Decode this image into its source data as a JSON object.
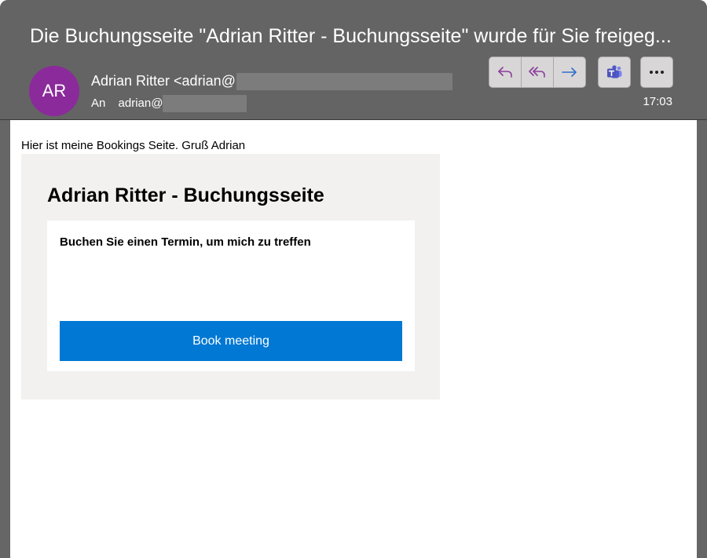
{
  "email": {
    "subject": "Die Buchungsseite \"Adrian Ritter - Buchungsseite\" wurde für Sie freigeg...",
    "avatar_initials": "AR",
    "sender_text": "Adrian Ritter <adrian@",
    "to_label": "An",
    "recipient_text": "adrian@",
    "time": "17:03"
  },
  "toolbar": {
    "reply_icon": "reply-icon",
    "reply_all_icon": "reply-all-icon",
    "forward_icon": "forward-icon",
    "teams_icon": "teams-icon",
    "more_icon": "more-icon",
    "more_label": "..."
  },
  "body": {
    "intro": "Hier ist meine Bookings Seite. Gruß Adrian",
    "card_title": "Adrian Ritter - Buchungsseite",
    "card_subtitle": "Buchen Sie einen Termin, um mich zu treffen",
    "book_button": "Book meeting"
  },
  "colors": {
    "header_bg": "#646464",
    "avatar_bg": "#8b2a9b",
    "accent_purple": "#8a3d9c",
    "forward_blue": "#2f6fce",
    "book_button_bg": "#0078d4",
    "card_bg": "#f2f1ef"
  }
}
